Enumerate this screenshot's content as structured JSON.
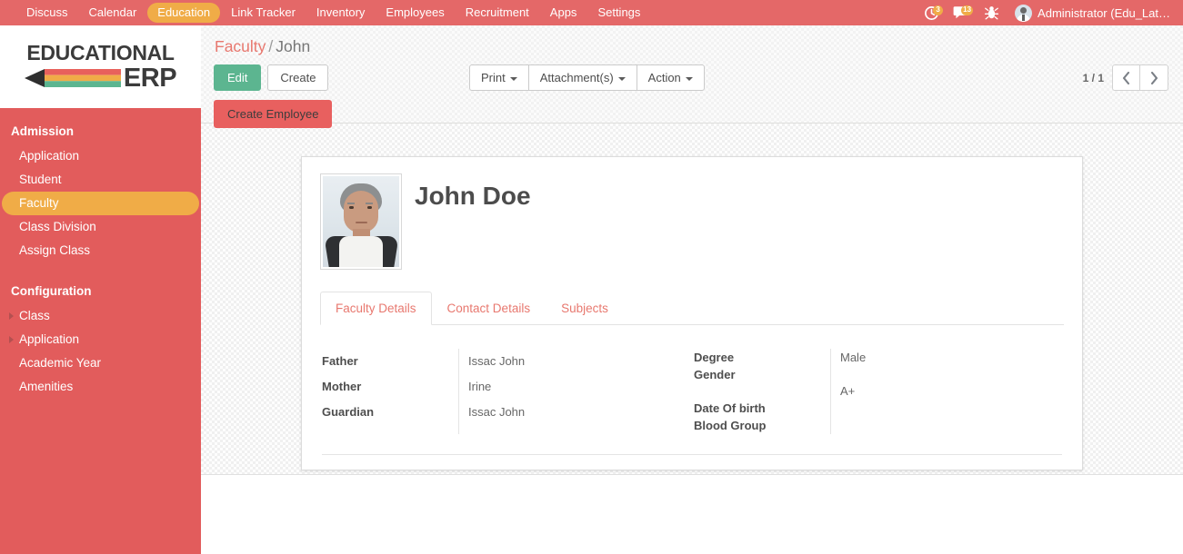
{
  "topnav": {
    "items": [
      {
        "label": "Discuss",
        "active": false
      },
      {
        "label": "Calendar",
        "active": false
      },
      {
        "label": "Education",
        "active": true
      },
      {
        "label": "Link Tracker",
        "active": false
      },
      {
        "label": "Inventory",
        "active": false
      },
      {
        "label": "Employees",
        "active": false
      },
      {
        "label": "Recruitment",
        "active": false
      },
      {
        "label": "Apps",
        "active": false
      },
      {
        "label": "Settings",
        "active": false
      }
    ],
    "activity_icon": "clock-icon",
    "activity_count": "3",
    "messages_icon": "chat-bubble-icon",
    "messages_count": "13",
    "debug_icon": "bug-icon",
    "user_icon": "avatar",
    "user_name": "Administrator (Edu_Lat…"
  },
  "sidebar": {
    "logo_line1": "EDUCATIONAL",
    "logo_line2": "ERP",
    "sections": [
      {
        "title": "Admission",
        "items": [
          {
            "label": "Application",
            "selected": false,
            "caret": false
          },
          {
            "label": "Student",
            "selected": false,
            "caret": false
          },
          {
            "label": "Faculty",
            "selected": true,
            "caret": false
          },
          {
            "label": "Class Division",
            "selected": false,
            "caret": false
          },
          {
            "label": "Assign Class",
            "selected": false,
            "caret": false
          }
        ]
      },
      {
        "title": "Configuration",
        "items": [
          {
            "label": "Class",
            "selected": false,
            "caret": true
          },
          {
            "label": "Application",
            "selected": false,
            "caret": true
          },
          {
            "label": "Academic Year",
            "selected": false,
            "caret": false
          },
          {
            "label": "Amenities",
            "selected": false,
            "caret": false
          }
        ]
      }
    ]
  },
  "control_panel": {
    "breadcrumb_root": "Faculty",
    "breadcrumb_sep": "/",
    "breadcrumb_current": "John",
    "edit_label": "Edit",
    "create_label": "Create",
    "print_label": "Print",
    "attachments_label": "Attachment(s)",
    "action_label": "Action",
    "pager_text": "1 / 1",
    "prev_icon": "chevron-left-icon",
    "next_icon": "chevron-right-icon",
    "create_employee_label": "Create Employee"
  },
  "record": {
    "name": "John Doe",
    "photo_alt": "faculty-photo",
    "tabs": [
      {
        "label": "Faculty Details",
        "active": true
      },
      {
        "label": "Contact Details",
        "active": false
      },
      {
        "label": "Subjects",
        "active": false
      }
    ],
    "left_group": {
      "labels": [
        "Father",
        "Mother",
        "Guardian"
      ],
      "values": [
        "Issac John",
        "Irine",
        "Issac John"
      ]
    },
    "right_group": {
      "labels": [
        "Degree",
        "Gender",
        "Date Of birth",
        "Blood Group"
      ],
      "values": [
        "",
        "Male",
        "",
        "A+"
      ]
    }
  },
  "colors": {
    "brand_red": "#e25c5c",
    "topbar_red": "#e46868",
    "accent_orange": "#f0ac47",
    "edit_green": "#5cb590",
    "link_coral": "#e8786f",
    "button_red": "#e8605f"
  }
}
